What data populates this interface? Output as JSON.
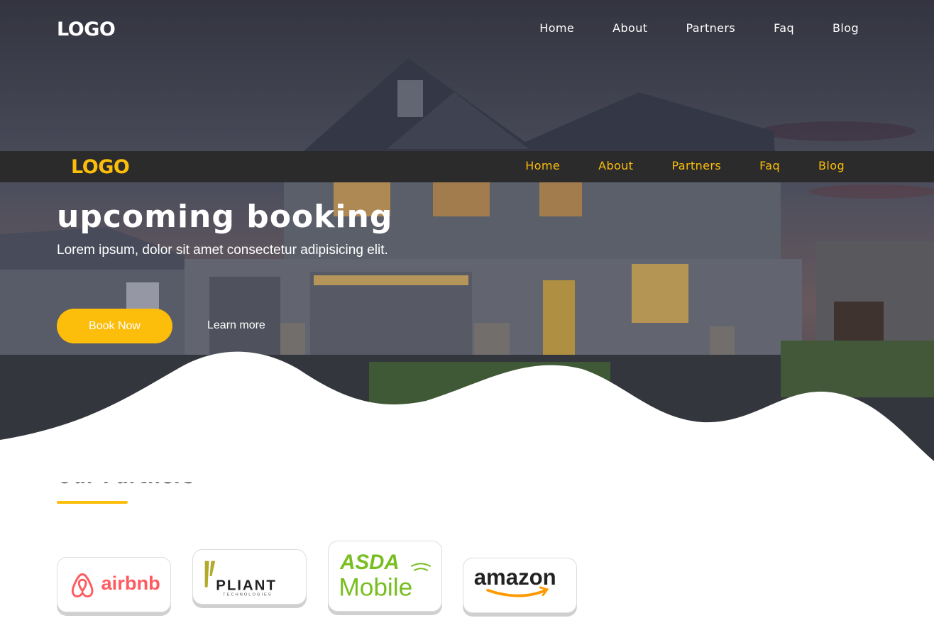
{
  "top_nav": {
    "logo": "LOGO",
    "items": [
      "Home",
      "About",
      "Partners",
      "Faq",
      "Blog"
    ]
  },
  "sticky_nav": {
    "logo": "LOGO",
    "items": [
      "Home",
      "About",
      "Partners",
      "Faq",
      "Blog"
    ]
  },
  "hero": {
    "title_line2": "upcoming booking",
    "subtitle": "Lorem ipsum, dolor sit amet consectetur adipisicing elit.",
    "book_button": "Book Now",
    "learn_more": "Learn more"
  },
  "partners": {
    "title": "Our Partners",
    "logos": [
      {
        "name": "airbnb",
        "text": "airbnb",
        "icon": "airbnb-logo"
      },
      {
        "name": "pliant",
        "text": "PLIANT",
        "subtext": "TECHNOLOGIES",
        "icon": "pliant-logo"
      },
      {
        "name": "asda",
        "text": "ASDA",
        "subtext": "Mobile",
        "icon": "asda-logo"
      },
      {
        "name": "amazon",
        "text": "amazon",
        "icon": "amazon-logo"
      }
    ]
  },
  "colors": {
    "accent": "#fdbd0b",
    "dark_nav": "#2b2b2b",
    "airbnb": "#ff5a5f",
    "asda": "#78be20",
    "amazon_arrow": "#ff9900"
  }
}
